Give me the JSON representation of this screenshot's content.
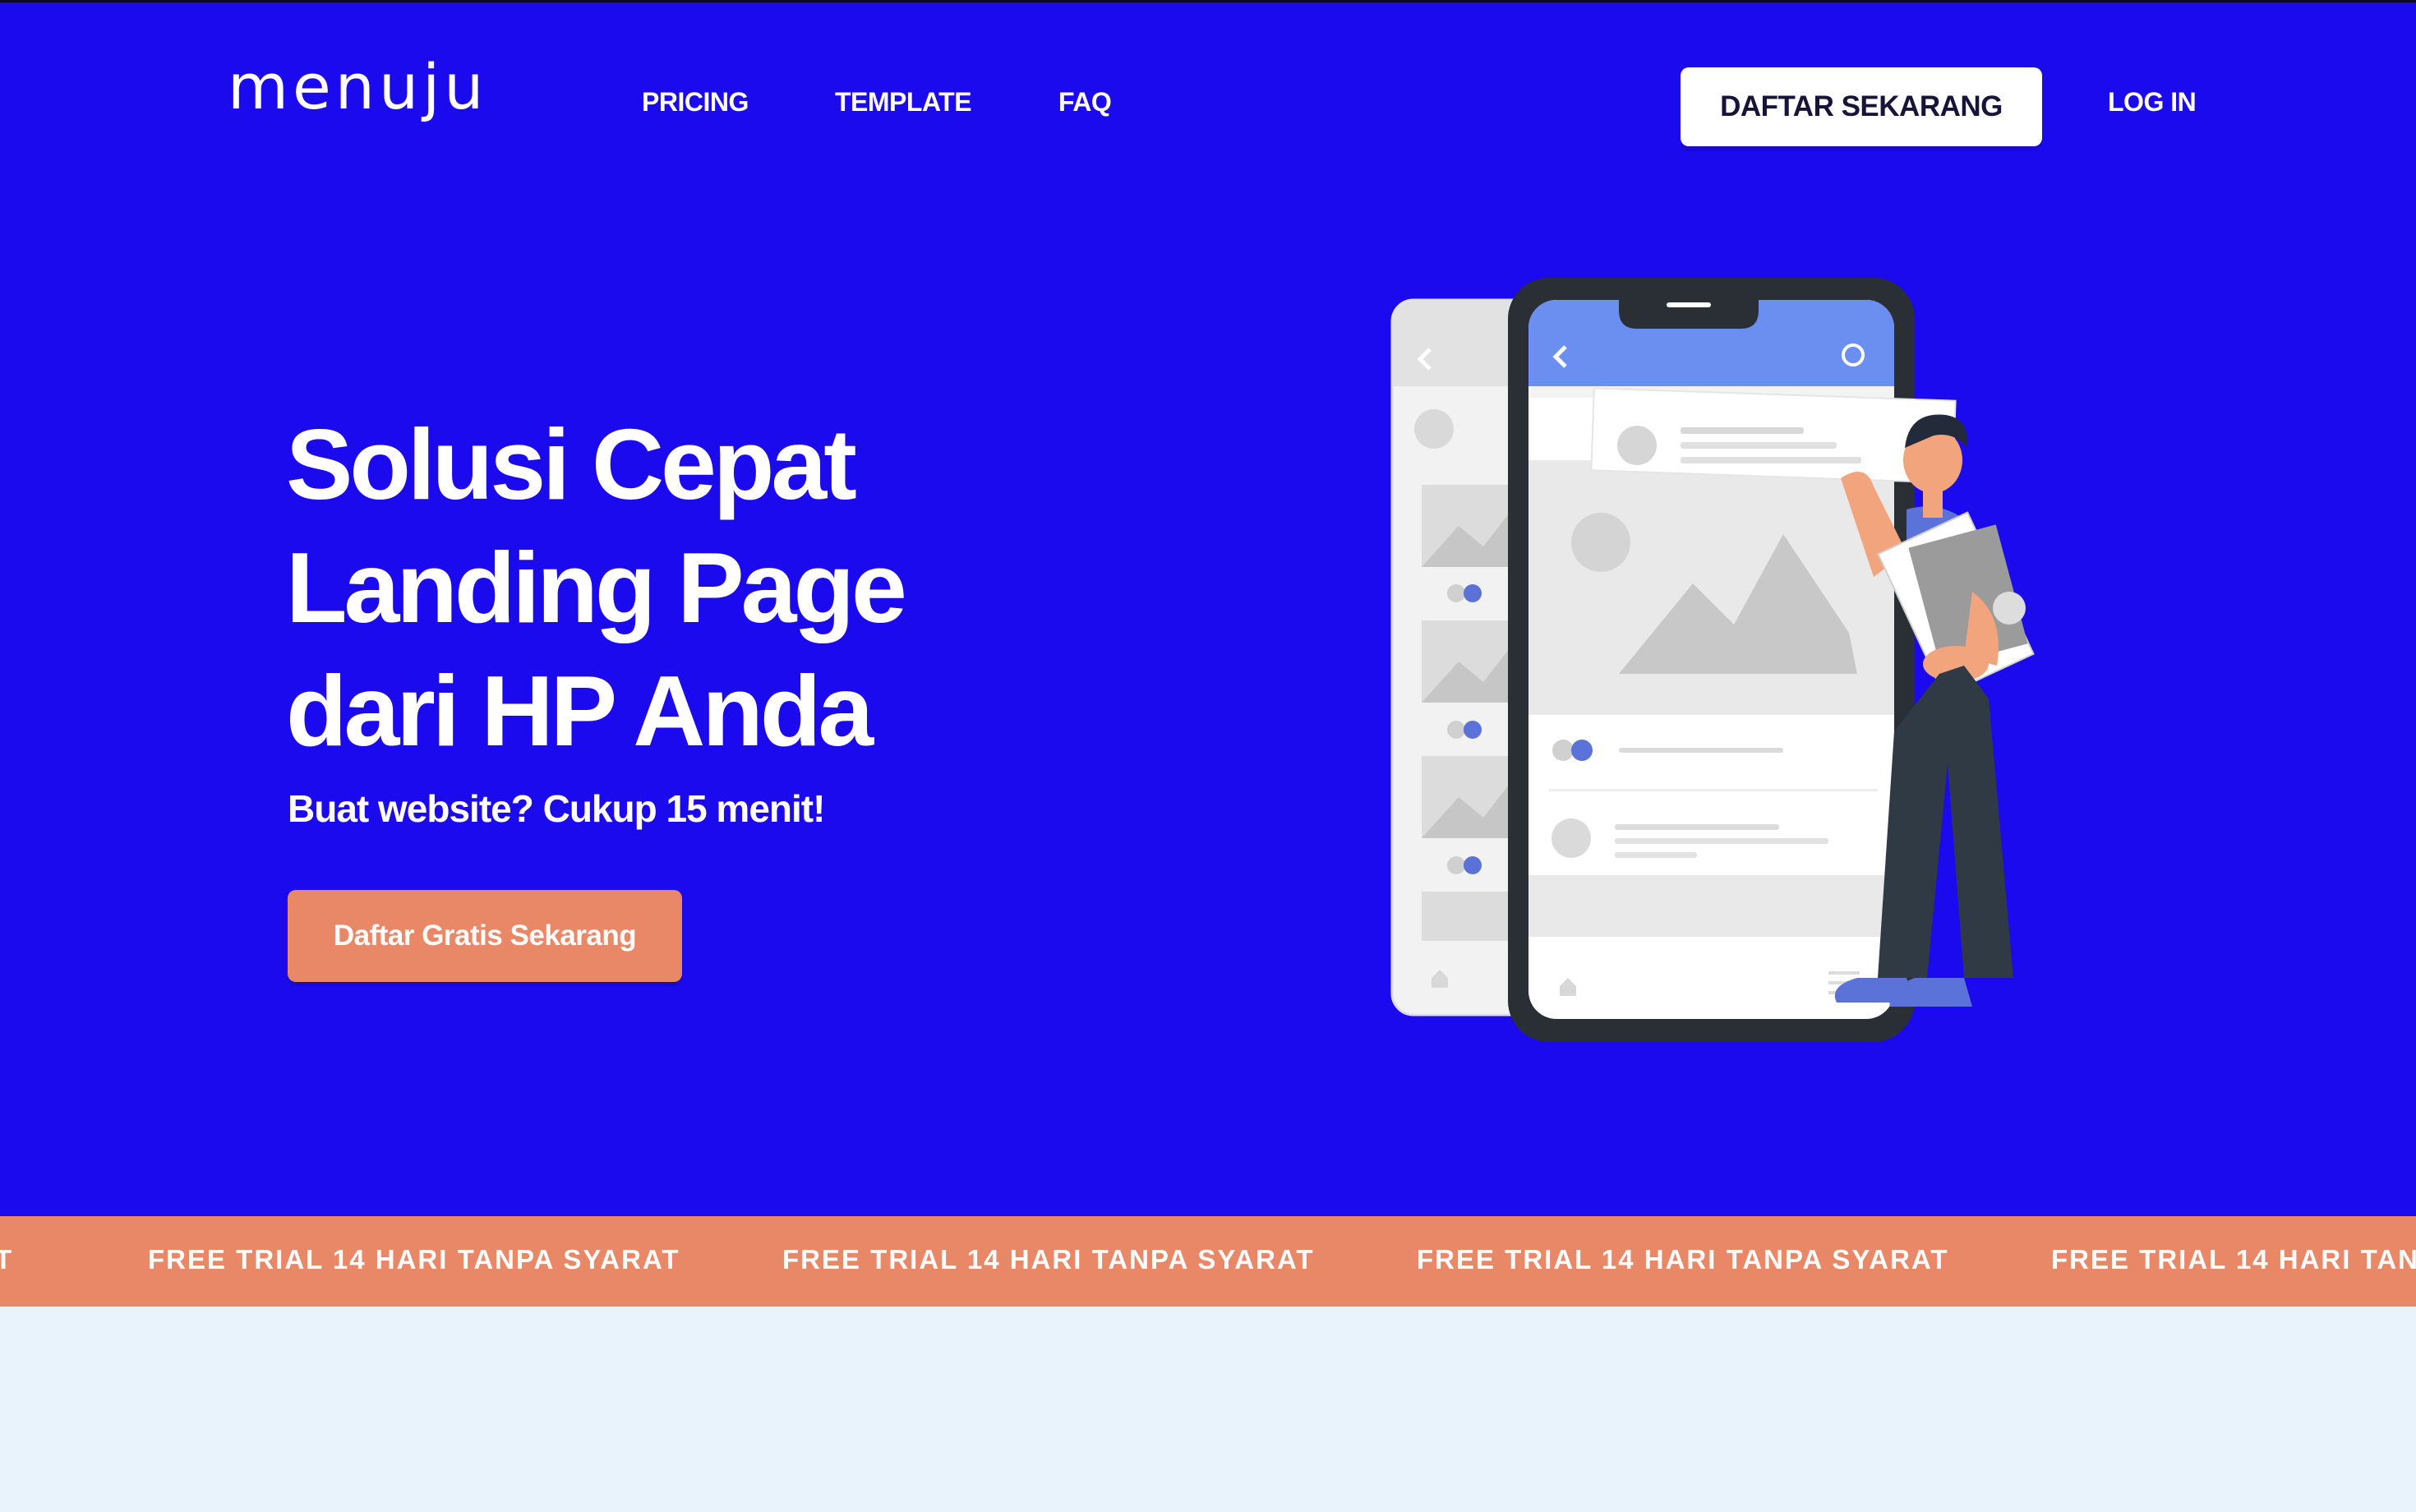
{
  "brand": {
    "logo": "menuju",
    "colors": {
      "hero_bg": "#1c0aee",
      "accent": "#e98866",
      "page_bg": "#e8f3fc"
    }
  },
  "nav": {
    "links": [
      "PRICING",
      "TEMPLATE",
      "FAQ"
    ],
    "signup_button": "DAFTAR SEKARANG",
    "login": "LOG IN"
  },
  "hero": {
    "headline_lines": [
      "Solusi Cepat",
      "Landing Page",
      "dari HP Anda"
    ],
    "subheadline": "Buat website? Cukup 15 menit!",
    "cta": "Daftar Gratis Sekarang",
    "illustration": "phone-mockup-with-person-illustration"
  },
  "banner": {
    "text": "FREE TRIAL 14 HARI TANPA SYARAT",
    "partial_left": "T",
    "partial_right": "FREE TRIAL 14 HARI TANP"
  }
}
